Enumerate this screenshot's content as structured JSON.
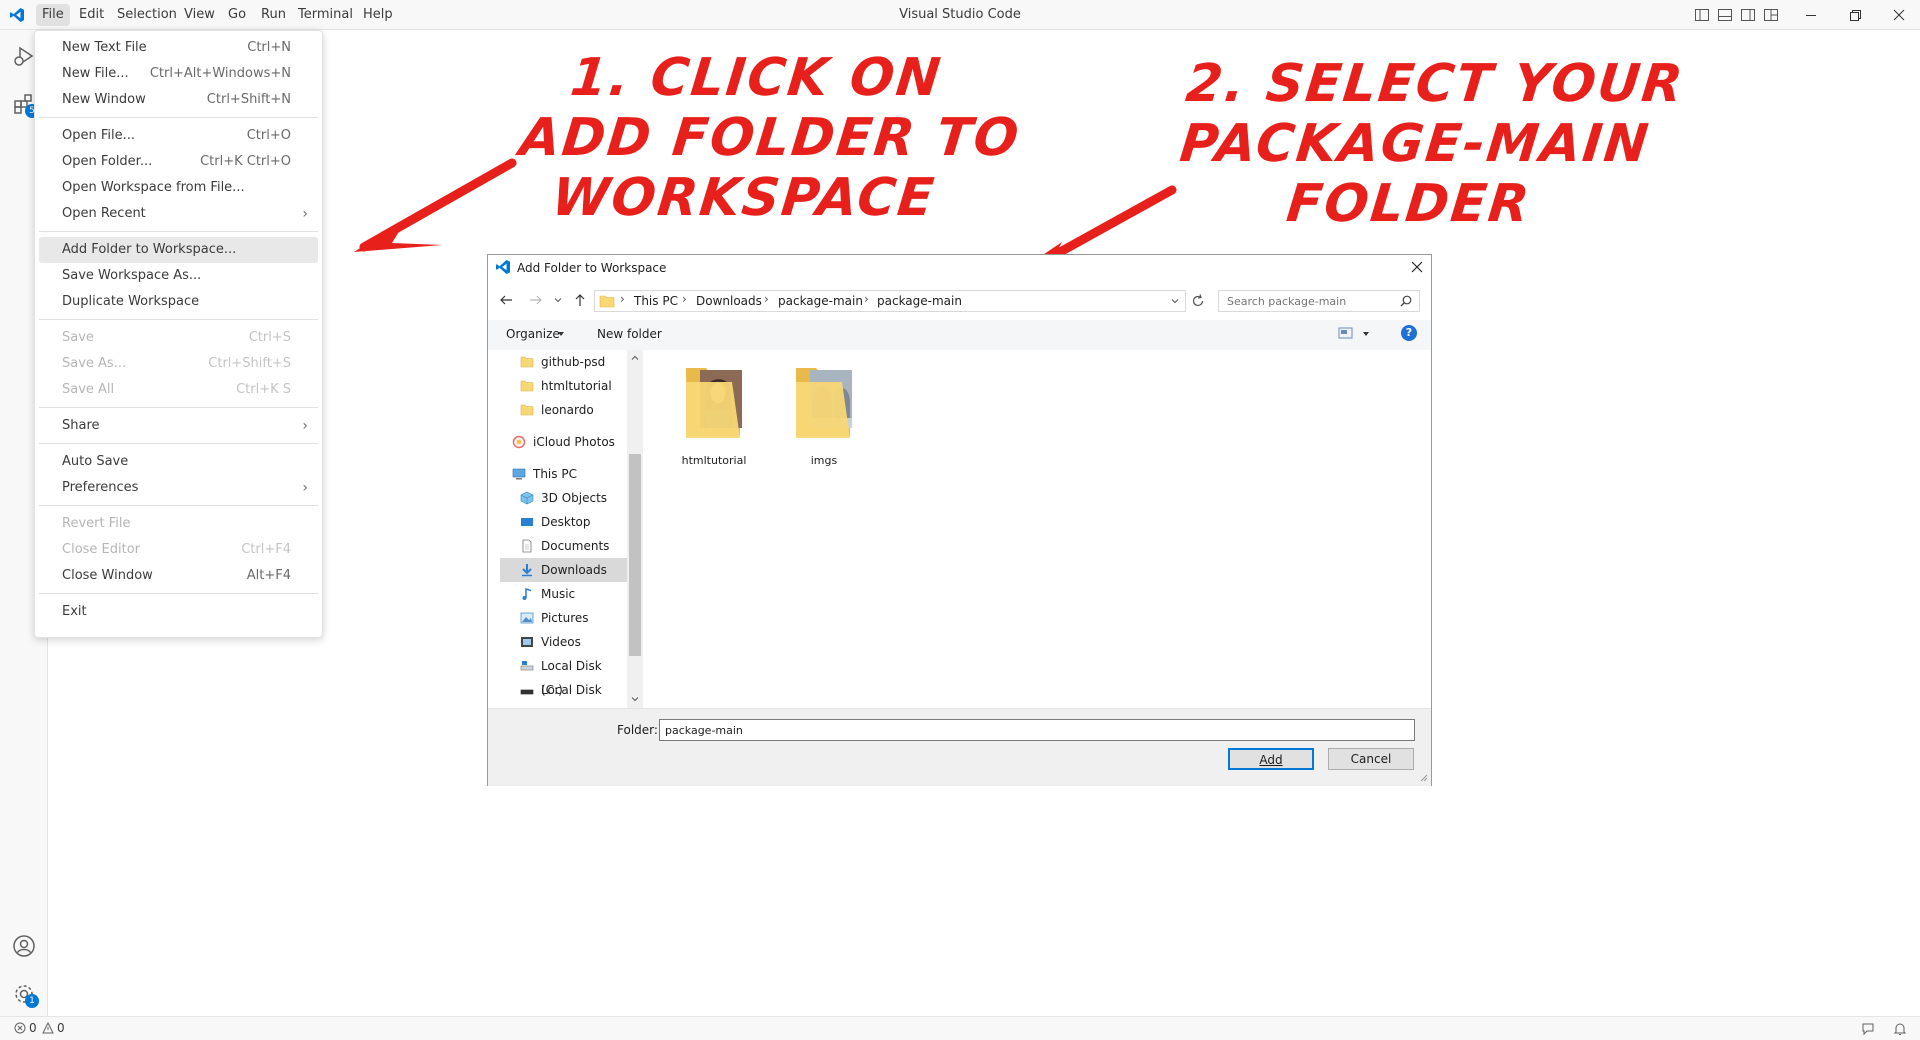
{
  "window": {
    "title": "Visual Studio Code",
    "menu": [
      "File",
      "Edit",
      "Selection",
      "View",
      "Go",
      "Run",
      "Terminal",
      "Help"
    ],
    "active_menu": "File"
  },
  "file_menu": {
    "items": [
      {
        "label": "New Text File",
        "shortcut": "Ctrl+N"
      },
      {
        "label": "New File...",
        "shortcut": "Ctrl+Alt+Windows+N"
      },
      {
        "label": "New Window",
        "shortcut": "Ctrl+Shift+N"
      },
      {
        "label": "Open File...",
        "shortcut": "Ctrl+O"
      },
      {
        "label": "Open Folder...",
        "shortcut": "Ctrl+K Ctrl+O"
      },
      {
        "label": "Open Workspace from File...",
        "shortcut": ""
      },
      {
        "label": "Open Recent",
        "shortcut": ""
      },
      {
        "label": "Add Folder to Workspace...",
        "shortcut": ""
      },
      {
        "label": "Save Workspace As...",
        "shortcut": ""
      },
      {
        "label": "Duplicate Workspace",
        "shortcut": ""
      },
      {
        "label": "Save",
        "shortcut": "Ctrl+S"
      },
      {
        "label": "Save As...",
        "shortcut": "Ctrl+Shift+S"
      },
      {
        "label": "Save All",
        "shortcut": "Ctrl+K S"
      },
      {
        "label": "Share",
        "shortcut": ""
      },
      {
        "label": "Auto Save",
        "shortcut": ""
      },
      {
        "label": "Preferences",
        "shortcut": ""
      },
      {
        "label": "Revert File",
        "shortcut": ""
      },
      {
        "label": "Close Editor",
        "shortcut": "Ctrl+F4"
      },
      {
        "label": "Close Window",
        "shortcut": "Alt+F4"
      },
      {
        "label": "Exit",
        "shortcut": ""
      }
    ]
  },
  "annotations": {
    "step1": [
      "1. CLICK ON",
      "ADD FOLDER TO",
      "WORKSPACE"
    ],
    "step2": [
      "2. SELECT YOUR",
      "PACKAGE-MAIN",
      "FOLDER"
    ]
  },
  "dialog": {
    "title": "Add Folder to Workspace",
    "breadcrumb": [
      "This PC",
      "Downloads",
      "package-main",
      "package-main"
    ],
    "search_placeholder": "Search package-main",
    "organize_label": "Organize",
    "new_folder_label": "New folder",
    "tree": [
      {
        "label": "github-psd",
        "icon": "folder-icon"
      },
      {
        "label": "htmltutorial",
        "icon": "folder-icon"
      },
      {
        "label": "leonardo",
        "icon": "folder-icon"
      },
      {
        "label": "iCloud Photos",
        "icon": "icloud-photos-icon"
      },
      {
        "label": "This PC",
        "icon": "computer-icon"
      },
      {
        "label": "3D Objects",
        "icon": "3d-objects-icon"
      },
      {
        "label": "Desktop",
        "icon": "desktop-icon"
      },
      {
        "label": "Documents",
        "icon": "documents-icon"
      },
      {
        "label": "Downloads",
        "icon": "downloads-icon"
      },
      {
        "label": "Music",
        "icon": "music-icon"
      },
      {
        "label": "Pictures",
        "icon": "pictures-icon"
      },
      {
        "label": "Videos",
        "icon": "videos-icon"
      },
      {
        "label": "Local Disk (C:)",
        "icon": "disk-icon"
      },
      {
        "label": "Local Disk (D:)",
        "icon": "disk-icon"
      }
    ],
    "files": [
      {
        "label": "htmltutorial"
      },
      {
        "label": "imgs"
      }
    ],
    "folder_label": "Folder:",
    "folder_value": "package-main",
    "add_button": "Add",
    "cancel_button": "Cancel"
  },
  "status": {
    "errors": "0",
    "warnings": "0"
  },
  "badges": {
    "extensions": "5",
    "settings": "1"
  },
  "colors": {
    "annotation_red": "#e8201c",
    "vscode_blue": "#0078d4",
    "folder_yellow": "#f8d775"
  }
}
